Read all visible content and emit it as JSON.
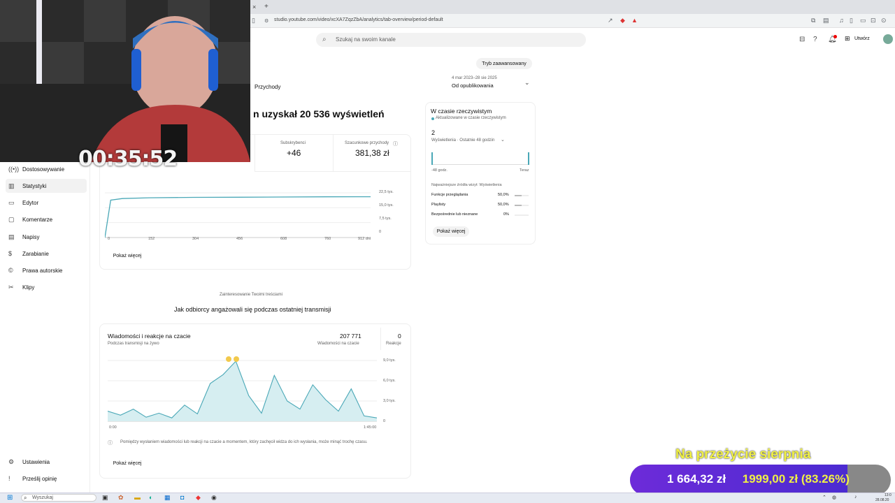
{
  "browser": {
    "url": "studio.youtube.com/video/xcXA7ZqzZbA/analytics/tab-overview/period-default",
    "new_tab": "+",
    "close_tab": "×"
  },
  "header": {
    "search_placeholder": "Szukaj na swoim kanale",
    "create_label": "Utwórz"
  },
  "top": {
    "advanced_mode": "Tryb zaawansowany",
    "date_range": "4 mar 2023–28 sie 2025",
    "period": "Od opublikowania",
    "tab_revenue": "Przychody"
  },
  "headline": "n uzyskał 20 536 wyświetleń",
  "metrics": {
    "subs_label": "Subskrybenci",
    "subs_value": "+46",
    "revenue_label": "Szacunkowe przychody",
    "revenue_value": "381,38 zł"
  },
  "show_more": "Pokaż więcej",
  "sidebar": {
    "items": [
      {
        "label": "Dostosowywanie",
        "icon": "broadcast-icon"
      },
      {
        "label": "Statystyki",
        "icon": "analytics-icon"
      },
      {
        "label": "Edytor",
        "icon": "editor-icon"
      },
      {
        "label": "Komentarze",
        "icon": "comments-icon"
      },
      {
        "label": "Napisy",
        "icon": "subtitles-icon"
      },
      {
        "label": "Zarabianie",
        "icon": "money-icon"
      },
      {
        "label": "Prawa autorskie",
        "icon": "copyright-icon"
      },
      {
        "label": "Klipy",
        "icon": "scissors-icon"
      }
    ],
    "settings": "Ustawienia",
    "feedback": "Prześlij opinię"
  },
  "views_chart": {
    "y_ticks": [
      "22,5 tys.",
      "15,0 tys.",
      "7,5 tys.",
      "0"
    ],
    "x_ticks": [
      "0",
      "152",
      "304",
      "456",
      "608",
      "760",
      "912 dni"
    ]
  },
  "chart_data": [
    {
      "type": "line",
      "x": [
        0,
        20,
        60,
        152,
        304,
        456,
        608,
        760,
        912
      ],
      "y": [
        0,
        18800,
        19600,
        20000,
        20200,
        20300,
        20400,
        20500,
        20536
      ],
      "xlabel": "",
      "ylabel": "",
      "ylim": [
        0,
        22500
      ],
      "xlim": [
        0,
        912
      ],
      "grid": true
    },
    {
      "type": "area",
      "x": [
        0,
        5,
        10,
        15,
        20,
        25,
        30,
        35,
        40,
        45,
        50,
        55,
        60,
        65,
        70,
        75,
        80,
        85,
        90,
        95,
        100,
        105
      ],
      "y": [
        1500,
        900,
        1800,
        600,
        1200,
        500,
        2400,
        1100,
        5600,
        6900,
        8900,
        3800,
        1200,
        6800,
        3000,
        1800,
        5400,
        3200,
        1500,
        4800,
        800,
        500
      ],
      "ylim": [
        0,
        9000
      ],
      "grid": true
    }
  ],
  "engagement": {
    "caption": "Zainteresowanie Twoimi treściami",
    "title": "Jak odbiorcy angażowali się podczas ostatniej transmisji",
    "card_title": "Wiadomości i reakcje na czacie",
    "card_subtitle": "Podczas transmisji na żywo",
    "messages_value": "207 771",
    "messages_label": "Wiadomości na czacie",
    "reactions_value": "0",
    "reactions_label": "Reakcje",
    "y_ticks": [
      "9,0 tys.",
      "6,0 tys.",
      "3,0 tys.",
      "0"
    ],
    "x_start": "0:00",
    "x_end": "1:45:00",
    "note": "Pomiędzy wysłaniem wiadomości lub reakcji na czacie a momentem, który zachęcił widza do ich wysłania, może minąć trochę czasu."
  },
  "realtime": {
    "title": "W czasie rzeczywistym",
    "updated": "Aktualizowane w czasie rzeczywistym",
    "value": "2",
    "views_period": "Wyświetlenia · Ostatnie 48 godzin",
    "left_label": "-48 godz.",
    "right_label": "Teraz",
    "sources_title": "Najważniejsze źródła wizyt: Wyświetlenia",
    "sources": [
      {
        "name": "Funkcje przeglądania",
        "value": "50,0%",
        "share": 0.5
      },
      {
        "name": "Playlisty",
        "value": "50,0%",
        "share": 0.5
      },
      {
        "name": "Bezpośrednie lub nieznane",
        "value": "0%",
        "share": 0
      }
    ]
  },
  "overlay": {
    "timer": "00:35:52",
    "goal_title": "Na przeżycie sierpnia",
    "goal_current": "1 664,32 zł",
    "goal_target": "1999,00 zł",
    "goal_percent": "(83.26%)",
    "goal_fraction": 0.8326
  },
  "taskbar": {
    "search": "Wyszukaj",
    "time": "13:0",
    "date": "28.08.20"
  },
  "colors": {
    "chart_line": "#4aa8b7",
    "chart_fill": "#d6eef1",
    "goal_text": "#f0f044",
    "goal_fill": "#5a2bd6"
  }
}
